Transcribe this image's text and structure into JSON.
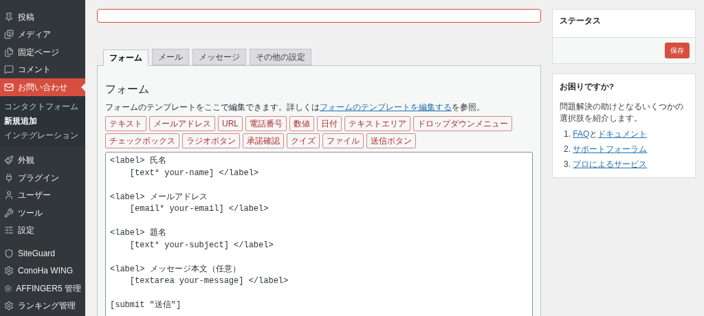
{
  "sidebar": {
    "items": [
      {
        "label": "投稿",
        "selected": false
      },
      {
        "label": "メディア",
        "selected": false
      },
      {
        "label": "固定ページ",
        "selected": false
      },
      {
        "label": "コメント",
        "selected": false
      },
      {
        "label": "お問い合わせ",
        "selected": true,
        "children": [
          {
            "label": "コンタクトフォーム",
            "selected": false
          },
          {
            "label": "新規追加",
            "selected": true
          },
          {
            "label": "インテグレーション",
            "selected": false
          }
        ]
      },
      {
        "label": "外観",
        "selected": false
      },
      {
        "label": "プラグイン",
        "selected": false
      },
      {
        "label": "ユーザー",
        "selected": false
      },
      {
        "label": "ツール",
        "selected": false
      },
      {
        "label": "設定",
        "selected": false
      },
      {
        "label": "SiteGuard",
        "selected": false
      },
      {
        "label": "ConoHa WING",
        "selected": false
      },
      {
        "label": "AFFINGER5 管理",
        "selected": false
      },
      {
        "label": "ランキング管理",
        "selected": false
      }
    ]
  },
  "tabs": [
    {
      "label": "フォーム",
      "selected": true
    },
    {
      "label": "メール",
      "selected": false
    },
    {
      "label": "メッセージ",
      "selected": false
    },
    {
      "label": "その他の設定",
      "selected": false
    }
  ],
  "form_panel": {
    "heading": "フォーム",
    "description_before": "フォームのテンプレートをここで編集できます。詳しくは",
    "description_link": "フォームのテンプレートを編集する",
    "description_after": "を参照。",
    "tag_buttons": [
      "テキスト",
      "メールアドレス",
      "URL",
      "電話番号",
      "数値",
      "日付",
      "テキストエリア",
      "ドロップダウンメニュー",
      "チェックボックス",
      "ラジオボタン",
      "承諾確認",
      "クイズ",
      "ファイル",
      "送信ボタン"
    ],
    "template": [
      [
        "<label> 氏名",
        "    [text* your-name] </label>"
      ],
      [
        "<label> メールアドレス",
        "    [email* your-email] </label>"
      ],
      [
        "<label> 題名",
        "    [text* your-subject] </label>"
      ],
      [
        "<label> メッセージ本文（任意）",
        "    [textarea your-message] </label>"
      ],
      [
        "[submit \"送信\"]"
      ]
    ]
  },
  "status_box": {
    "title": "ステータス",
    "save_button": "保存"
  },
  "help_box": {
    "title": "お困りですか?",
    "description": "問題解決の助けとなるいくつかの選択肢を紹介します。",
    "links": [
      [
        {
          "text": "1. ",
          "kind": "plain"
        },
        {
          "text": "FAQ",
          "kind": "link"
        },
        {
          "text": "と",
          "kind": "plain"
        },
        {
          "text": "ドキュメント",
          "kind": "link"
        }
      ],
      [
        {
          "text": "2. ",
          "kind": "plain"
        },
        {
          "text": "サポートフォーラム",
          "kind": "link"
        }
      ],
      [
        {
          "text": "3. ",
          "kind": "plain"
        },
        {
          "text": "プロによるサービス",
          "kind": "link"
        }
      ]
    ]
  }
}
